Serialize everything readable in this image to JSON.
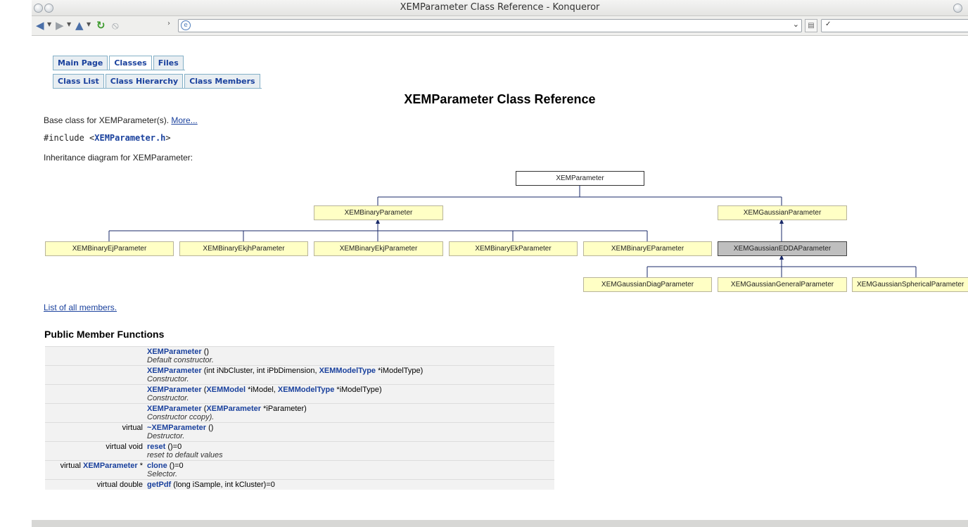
{
  "window": {
    "title": "XEMParameter Class Reference - Konqueror"
  },
  "navbar": {
    "tabs_top": [
      "Main Page",
      "Classes",
      "Files"
    ],
    "tabs_sub": [
      "Class List",
      "Class Hierarchy",
      "Class Members"
    ]
  },
  "page": {
    "title": "XEMParameter Class Reference",
    "base_text": "Base class for XEMParameter(s). ",
    "more_link": "More...",
    "include_prefix": "#include <",
    "include_file": "XEMParameter.h",
    "include_suffix": ">",
    "inheritance_label": "Inheritance diagram for XEMParameter:",
    "list_members_link": "List of all members.",
    "section_title": "Public Member Functions"
  },
  "diagram": {
    "root": "XEMParameter",
    "level1": [
      "XEMBinaryParameter",
      "XEMGaussianParameter"
    ],
    "binary_children": [
      "XEMBinaryEjParameter",
      "XEMBinaryEkjhParameter",
      "XEMBinaryEkjParameter",
      "XEMBinaryEkParameter",
      "XEMBinaryEParameter"
    ],
    "gaussian_child": "XEMGaussianEDDAParameter",
    "edda_children": [
      "XEMGaussianDiagParameter",
      "XEMGaussianGeneralParameter",
      "XEMGaussianSphericalParameter"
    ]
  },
  "members": [
    {
      "left": "",
      "name": "XEMParameter",
      "sig": " ()",
      "desc": "Default constructor."
    },
    {
      "left": "",
      "name": "XEMParameter",
      "sig": " (int iNbCluster, int iPbDimension, ",
      "type1": "XEMModelType",
      "sig2": " *iModelType)",
      "desc": "Constructor."
    },
    {
      "left": "",
      "name": "XEMParameter",
      "sig": " (",
      "type1": "XEMModel",
      "sig2": " *iModel, ",
      "type2": "XEMModelType",
      "sig3": " *iModelType)",
      "desc": "Constructor."
    },
    {
      "left": "",
      "name": "XEMParameter",
      "sig": " (",
      "type1": "XEMParameter",
      "sig2": " *iParameter)",
      "desc": "Constructor ccopy)."
    },
    {
      "left": "virtual",
      "name": "~XEMParameter",
      "sig": " ()",
      "desc": "Destructor."
    },
    {
      "left": "virtual void",
      "name": "reset",
      "sig": " ()=0",
      "desc": "reset to default values"
    },
    {
      "left_prefix": "virtual ",
      "left_type": "XEMParameter",
      "left_suffix": " *",
      "name": "clone",
      "sig": " ()=0",
      "desc": "Selector."
    },
    {
      "left": "virtual double",
      "name": "getPdf",
      "sig": " (long iSample, int kCluster)=0",
      "desc": ""
    }
  ]
}
